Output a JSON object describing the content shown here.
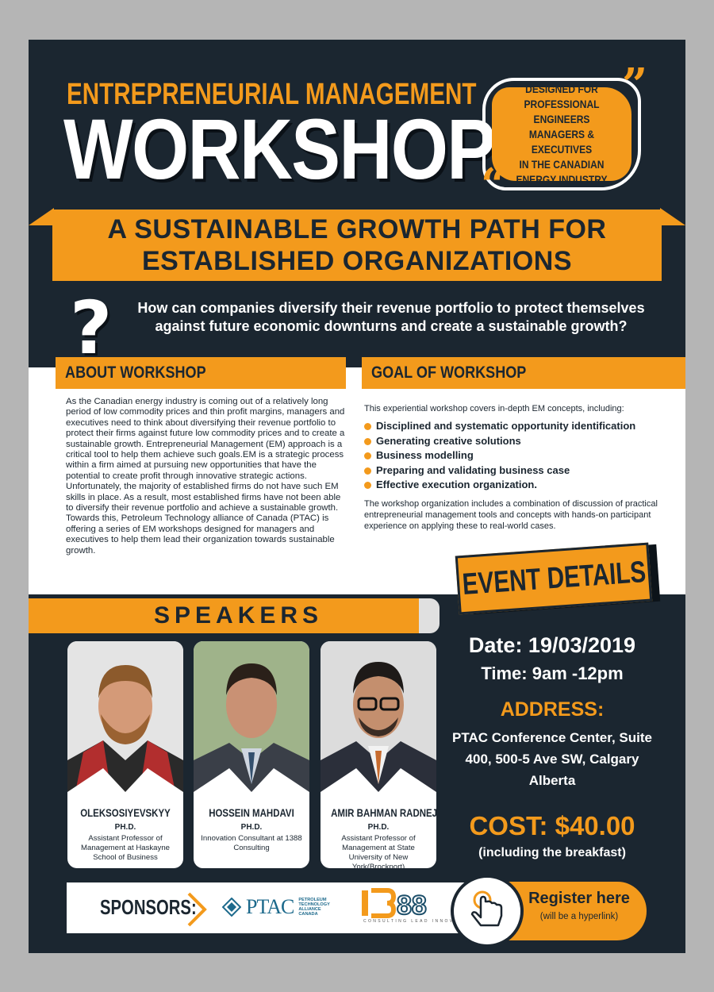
{
  "header": {
    "kicker": "ENTREPRENEURIAL MANAGEMENT",
    "title": "WORKSHOP"
  },
  "audience": {
    "lines": [
      "DESIGNED FOR",
      "PROFESSIONAL ENGINEERS",
      "MANAGERS & EXECUTIVES",
      "IN THE CANADIAN",
      "ENERGY INDUSTRY"
    ]
  },
  "banner": {
    "line1": "A SUSTAINABLE GROWTH PATH FOR",
    "line2": "ESTABLISHED ORGANIZATIONS"
  },
  "question": {
    "mark": "?",
    "text": "How can companies diversify their revenue portfolio to protect themselves against future economic downturns and create a sustainable growth?"
  },
  "about": {
    "title": "ABOUT WORKSHOP",
    "body": "As the Canadian energy industry is coming out of a relatively long period of low commodity prices and thin profit margins, managers and executives need to think about diversifying their revenue portfolio to protect their firms against future low commodity prices and to create a sustainable growth. Entrepreneurial Management (EM) approach is a critical tool to help them achieve such goals.EM is a strategic process within a firm aimed at pursuing new opportunities that have the potential to create profit through innovative strategic actions. Unfortunately, the majority of established firms do not have such EM skills in place. As a result, most established firms have not been able to diversify their revenue portfolio and achieve a sustainable growth. Towards this, Petroleum Technology alliance of Canada (PTAC) is offering a series of EM workshops designed for managers and executives to help them lead their organization towards sustainable growth."
  },
  "goal": {
    "title": "GOAL OF WORKSHOP",
    "intro": "This experiential workshop covers in-depth EM concepts, including:",
    "items": [
      "Disciplined and systematic opportunity identification",
      "Generating creative solutions",
      "Business modelling",
      "Preparing and validating business case",
      "Effective execution organization."
    ],
    "outro": "The workshop organization includes a combination of discussion of practical entrepreneurial management tools and concepts with hands-on participant experience on applying these to real-world cases."
  },
  "event": {
    "title": "EVENT DETAILS",
    "date": "Date: 19/03/2019",
    "time": "Time: 9am -12pm",
    "address_label": "ADDRESS:",
    "address": "PTAC Conference Center, Suite 400, 500-5 Ave SW, Calgary Alberta",
    "cost": "COST: $40.00",
    "cost_note": "(including the breakfast)"
  },
  "speakers": {
    "title": "SPEAKERS",
    "list": [
      {
        "name": "OLEKSOSIYEVSKYY",
        "degree": "PH.D.",
        "role": "Assistant Professor of Management at Haskayne School of Business"
      },
      {
        "name": "HOSSEIN MAHDAVI",
        "degree": "PH.D.",
        "role": "Innovation Consultant at 1388 Consulting"
      },
      {
        "name": "AMIR BAHMAN RADNEJAD",
        "degree": "PH.D.",
        "role": "Assistant Professor of Management at State University of New York(Brockport)"
      }
    ]
  },
  "sponsors": {
    "label": "SPONSORS:",
    "ptac_word": "PTAC",
    "ptac_small": [
      "PETROLEUM",
      "TECHNOLOGY",
      "ALLIANCE",
      "CANADA"
    ],
    "consulting_number": "88",
    "consulting_tagline": "CONSULTING LEAD INNOVATE GROW"
  },
  "register": {
    "label": "Register here",
    "note": "(will be a hyperlink)"
  },
  "colors": {
    "background": "#1b2630",
    "accent": "#f39a1c",
    "frame": "#b5b5b5"
  }
}
